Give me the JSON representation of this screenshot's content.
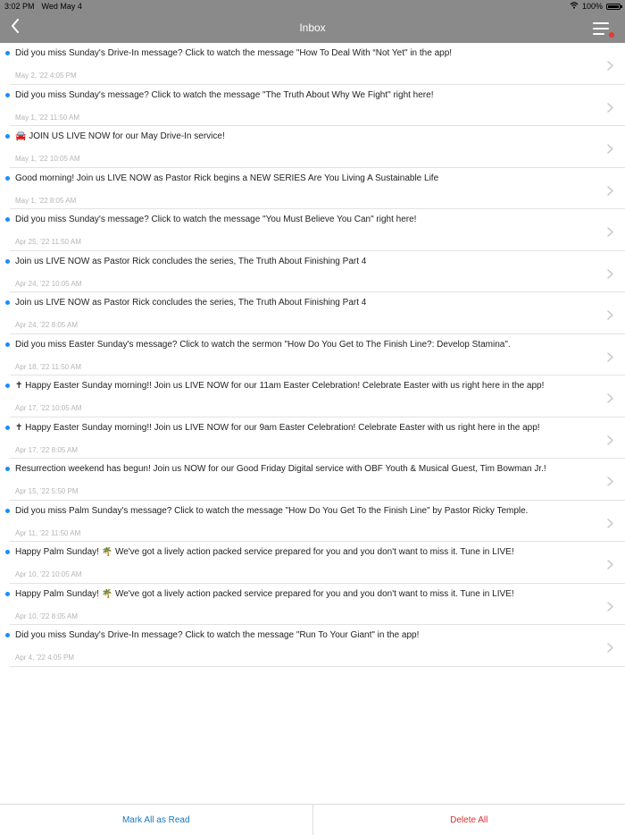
{
  "status": {
    "time": "3:02 PM",
    "date": "Wed May 4",
    "battery": "100%",
    "battery_level": 1.0
  },
  "nav": {
    "title": "Inbox",
    "back_icon": "chevron-left-icon",
    "menu_icon": "menu-icon"
  },
  "colors": {
    "bar": "#8a8a8a",
    "unread_dot": "#1a8cff",
    "menu_badge": "#e53935",
    "mark_all": "#1a78c2",
    "delete_all": "#d93030"
  },
  "messages": [
    {
      "title": "Did you miss Sunday's Drive-In message? Click to watch the message \"How To Deal With “Not Yet\" in the app!",
      "date": "May 2, '22 4:05 PM"
    },
    {
      "title": "Did you miss Sunday's message? Click to watch the message \"The Truth About Why We Fight\" right here!",
      "date": "May 1, '22 11:50 AM"
    },
    {
      "title": "🚘 JOIN US LIVE NOW for our May Drive-In service!",
      "date": "May 1, '22 10:05 AM"
    },
    {
      "title": "Good morning! Join us LIVE NOW as Pastor Rick begins a NEW SERIES Are You Living A Sustainable Life",
      "date": "May 1, '22 8:05 AM"
    },
    {
      "title": "Did you miss Sunday's message? Click to watch the message \"You Must Believe You Can\" right here!",
      "date": "Apr 25, '22 11:50 AM"
    },
    {
      "title": "Join us LIVE NOW as Pastor Rick concludes the series, The Truth About Finishing Part 4",
      "date": "Apr 24, '22 10:05 AM"
    },
    {
      "title": "Join us LIVE NOW as Pastor Rick concludes the series, The Truth About Finishing Part 4",
      "date": "Apr 24, '22 8:05 AM"
    },
    {
      "title": "Did you miss Easter Sunday's message? Click to watch the sermon \"How Do You Get to The Finish Line?: Develop Stamina\".",
      "date": "Apr 18, '22 11:50 AM"
    },
    {
      "title": "✝ Happy Easter Sunday morning!! Join us LIVE NOW for our 11am Easter Celebration! Celebrate Easter with us right here in the app!",
      "date": "Apr 17, '22 10:05 AM"
    },
    {
      "title": "✝ Happy Easter Sunday morning!! Join us LIVE NOW for our 9am Easter Celebration! Celebrate Easter with us right here in the app!",
      "date": "Apr 17, '22 8:05 AM"
    },
    {
      "title": "Resurrection weekend has begun! Join us NOW for our Good Friday Digital service with OBF Youth & Musical Guest, Tim Bowman Jr.!",
      "date": "Apr 15, '22 5:50 PM"
    },
    {
      "title": "Did you miss Palm Sunday's message? Click to watch the message \"How Do You Get To the Finish Line\" by Pastor Ricky Temple.",
      "date": "Apr 11, '22 11:50 AM"
    },
    {
      "title": "Happy Palm Sunday! 🌴 We've got a lively action packed service prepared for you and you don't want to miss it. Tune in LIVE!",
      "date": "Apr 10, '22 10:05 AM"
    },
    {
      "title": "Happy Palm Sunday! 🌴 We've got a lively action packed service prepared for you and you don't want to miss it. Tune in LIVE!",
      "date": "Apr 10, '22 8:05 AM"
    },
    {
      "title": "Did you miss Sunday's Drive-In message? Click to watch the message \"Run To Your Giant\" in the app!",
      "date": "Apr 4, '22 4:05 PM"
    }
  ],
  "footer": {
    "mark_all_label": "Mark All as Read",
    "delete_all_label": "Delete All"
  }
}
